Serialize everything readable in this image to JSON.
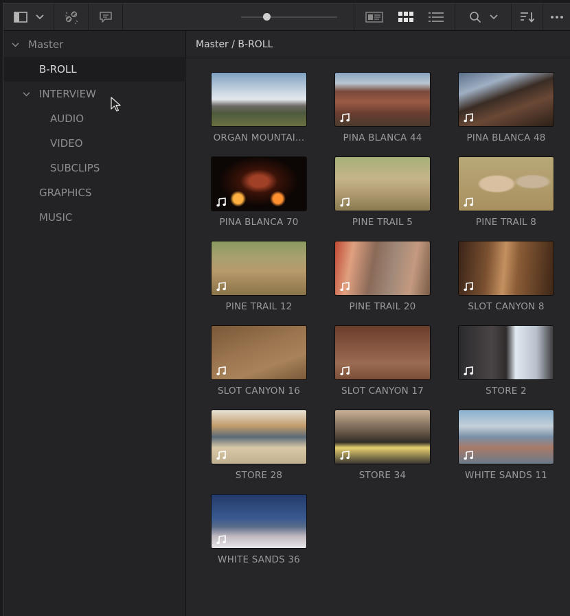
{
  "toolbar": {
    "icons": [
      "sidebar-toggle-icon",
      "chevron-down-icon",
      "unlink-icon",
      "comment-icon",
      "zoom-slider",
      "metadata-view-icon",
      "thumbnail-view-icon",
      "list-view-icon",
      "search-icon",
      "sort-icon",
      "more-icon"
    ]
  },
  "sidebar": {
    "root": "Master",
    "items": [
      {
        "label": "B-ROLL",
        "level": 1,
        "selected": true
      },
      {
        "label": "INTERVIEW",
        "level": 1,
        "expanded": true
      },
      {
        "label": "AUDIO",
        "level": 2
      },
      {
        "label": "VIDEO",
        "level": 2
      },
      {
        "label": "SUBCLIPS",
        "level": 2
      },
      {
        "label": "GRAPHICS",
        "level": 1
      },
      {
        "label": "MUSIC",
        "level": 1
      }
    ]
  },
  "breadcrumb": "Master / B-ROLL",
  "clips": [
    {
      "name": "ORGAN MOUNTAI...",
      "audio": false,
      "scene": "mountains-sky"
    },
    {
      "name": "PINA BLANCA 44",
      "audio": true,
      "scene": "red-hills"
    },
    {
      "name": "PINA BLANCA 48",
      "audio": true,
      "scene": "dark-rocks"
    },
    {
      "name": "PINA BLANCA 70",
      "audio": true,
      "scene": "fire-night"
    },
    {
      "name": "PINE TRAIL 5",
      "audio": true,
      "scene": "desert-shrub"
    },
    {
      "name": "PINE TRAIL 8",
      "audio": true,
      "scene": "boulders"
    },
    {
      "name": "PINE TRAIL 12",
      "audio": true,
      "scene": "trail-steps"
    },
    {
      "name": "PINE TRAIL 20",
      "audio": true,
      "scene": "hand-sign"
    },
    {
      "name": "SLOT CANYON 8",
      "audio": true,
      "scene": "canyon"
    },
    {
      "name": "SLOT CANYON 16",
      "audio": true,
      "scene": "sand"
    },
    {
      "name": "SLOT CANYON 17",
      "audio": true,
      "scene": "hand-wall"
    },
    {
      "name": "STORE 2",
      "audio": true,
      "scene": "monitor"
    },
    {
      "name": "STORE 28",
      "audio": true,
      "scene": "storefront"
    },
    {
      "name": "STORE 34",
      "audio": true,
      "scene": "store-interior"
    },
    {
      "name": "WHITE SANDS 11",
      "audio": true,
      "scene": "group-people"
    },
    {
      "name": "WHITE SANDS 36",
      "audio": true,
      "scene": "dune-people"
    }
  ]
}
